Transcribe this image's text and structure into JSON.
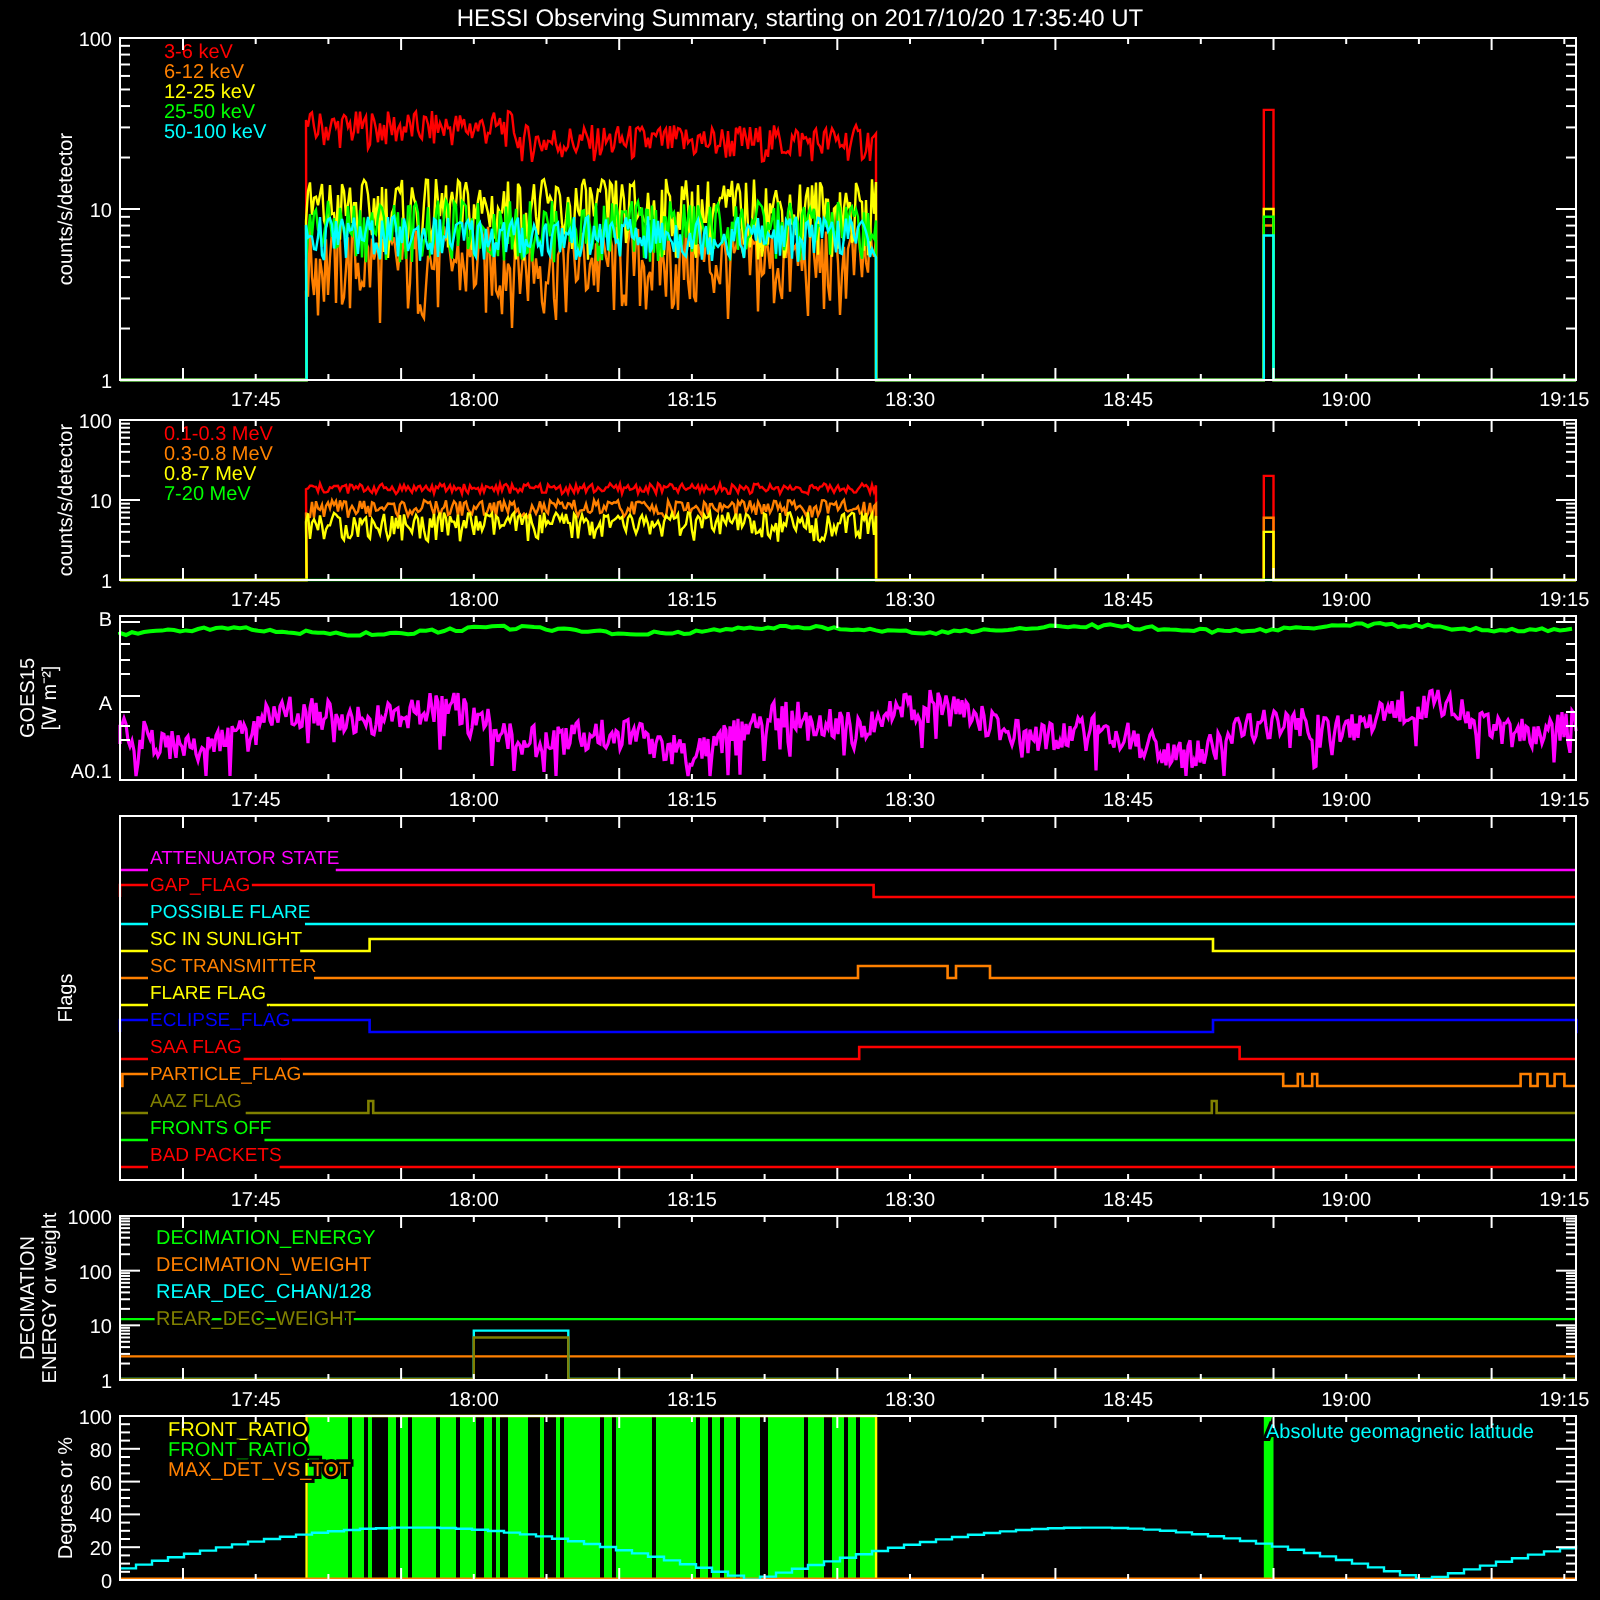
{
  "title": "HESSI Observing Summary, starting on 2017/10/20 17:35:40 UT",
  "panels": [
    {
      "kind": "counts",
      "y_title": [
        "counts/s/detector"
      ],
      "y_ticks": [
        "100",
        "10",
        "1"
      ],
      "x_ticks": [
        "17:45",
        "18:00",
        "18:15",
        "18:30",
        "18:45",
        "19:00",
        "19:15"
      ],
      "legend": [
        {
          "label": "3-6 keV",
          "color": "#ff0000"
        },
        {
          "label": "6-12 keV",
          "color": "#ff8000"
        },
        {
          "label": "12-25 keV",
          "color": "#ffff00"
        },
        {
          "label": "25-50 keV",
          "color": "#00ff00"
        },
        {
          "label": "50-100 keV",
          "color": "#00ffff"
        }
      ]
    },
    {
      "kind": "counts",
      "y_title": [
        "counts/s/detector"
      ],
      "y_ticks": [
        "100",
        "10",
        "1"
      ],
      "x_ticks": [
        "17:45",
        "18:00",
        "18:15",
        "18:30",
        "18:45",
        "19:00",
        "19:15"
      ],
      "legend": [
        {
          "label": "0.1-0.3 MeV",
          "color": "#ff0000"
        },
        {
          "label": "0.3-0.8 MeV",
          "color": "#ff8000"
        },
        {
          "label": "0.8-7 MeV",
          "color": "#ffff00"
        },
        {
          "label": "7-20 MeV",
          "color": "#00ff00"
        }
      ]
    },
    {
      "kind": "goes",
      "y_title": [
        "GOES15",
        "[W m⁻²]"
      ],
      "y_ticks": [
        "B",
        "A",
        "A0.1"
      ],
      "x_ticks": [
        "17:45",
        "18:00",
        "18:15",
        "18:30",
        "18:45",
        "19:00",
        "19:15"
      ],
      "legend": [
        {
          "color": "#00ff00"
        },
        {
          "color": "#ff00ff"
        }
      ]
    },
    {
      "kind": "flags",
      "y_title": [
        "Flags"
      ],
      "x_ticks": [
        "17:45",
        "18:00",
        "18:15",
        "18:30",
        "18:45",
        "19:00",
        "19:15"
      ],
      "flags": [
        {
          "label": "ATTENUATOR STATE",
          "color": "#ff00ff"
        },
        {
          "label": "GAP_FLAG",
          "color": "#ff0000"
        },
        {
          "label": "POSSIBLE FLARE",
          "color": "#00ffff"
        },
        {
          "label": "SC IN SUNLIGHT",
          "color": "#ffff00"
        },
        {
          "label": "SC TRANSMITTER",
          "color": "#ff8000"
        },
        {
          "label": "FLARE FLAG",
          "color": "#ffff00"
        },
        {
          "label": "ECLIPSE_FLAG",
          "color": "#0000ff"
        },
        {
          "label": "SAA FLAG",
          "color": "#ff0000"
        },
        {
          "label": "PARTICLE_FLAG",
          "color": "#ff8000"
        },
        {
          "label": "AAZ FLAG",
          "color": "#808000"
        },
        {
          "label": "FRONTS OFF",
          "color": "#00ff00"
        },
        {
          "label": "BAD PACKETS",
          "color": "#ff0000"
        }
      ]
    },
    {
      "kind": "decimation",
      "y_title": [
        "DECIMATION",
        "ENERGY or weight"
      ],
      "y_ticks": [
        "1000",
        "100",
        "10",
        "1"
      ],
      "x_ticks": [
        "17:45",
        "18:00",
        "18:15",
        "18:30",
        "18:45",
        "19:00",
        "19:15"
      ],
      "legend": [
        {
          "label": "DECIMATION_ENERGY",
          "color": "#00ff00"
        },
        {
          "label": "DECIMATION_WEIGHT",
          "color": "#ff8000"
        },
        {
          "label": "REAR_DEC_CHAN/128",
          "color": "#00ffff"
        },
        {
          "label": "REAR_DEC_WEIGHT",
          "color": "#808000"
        }
      ]
    },
    {
      "kind": "ratio",
      "y_title": [
        "Degrees or %"
      ],
      "y_ticks": [
        "100",
        "80",
        "60",
        "40",
        "20",
        "0"
      ],
      "legend": [
        {
          "label": "FRONT_RATIO",
          "color": "#ffff00"
        },
        {
          "label": "FRONT_RATIO_",
          "color": "#00ff00"
        },
        {
          "label": "MAX_DET_VS_TOT",
          "color": "#ff8000"
        }
      ],
      "note": {
        "label": "Absolute geomagnetic latitude",
        "color": "#00ffff"
      }
    }
  ]
}
